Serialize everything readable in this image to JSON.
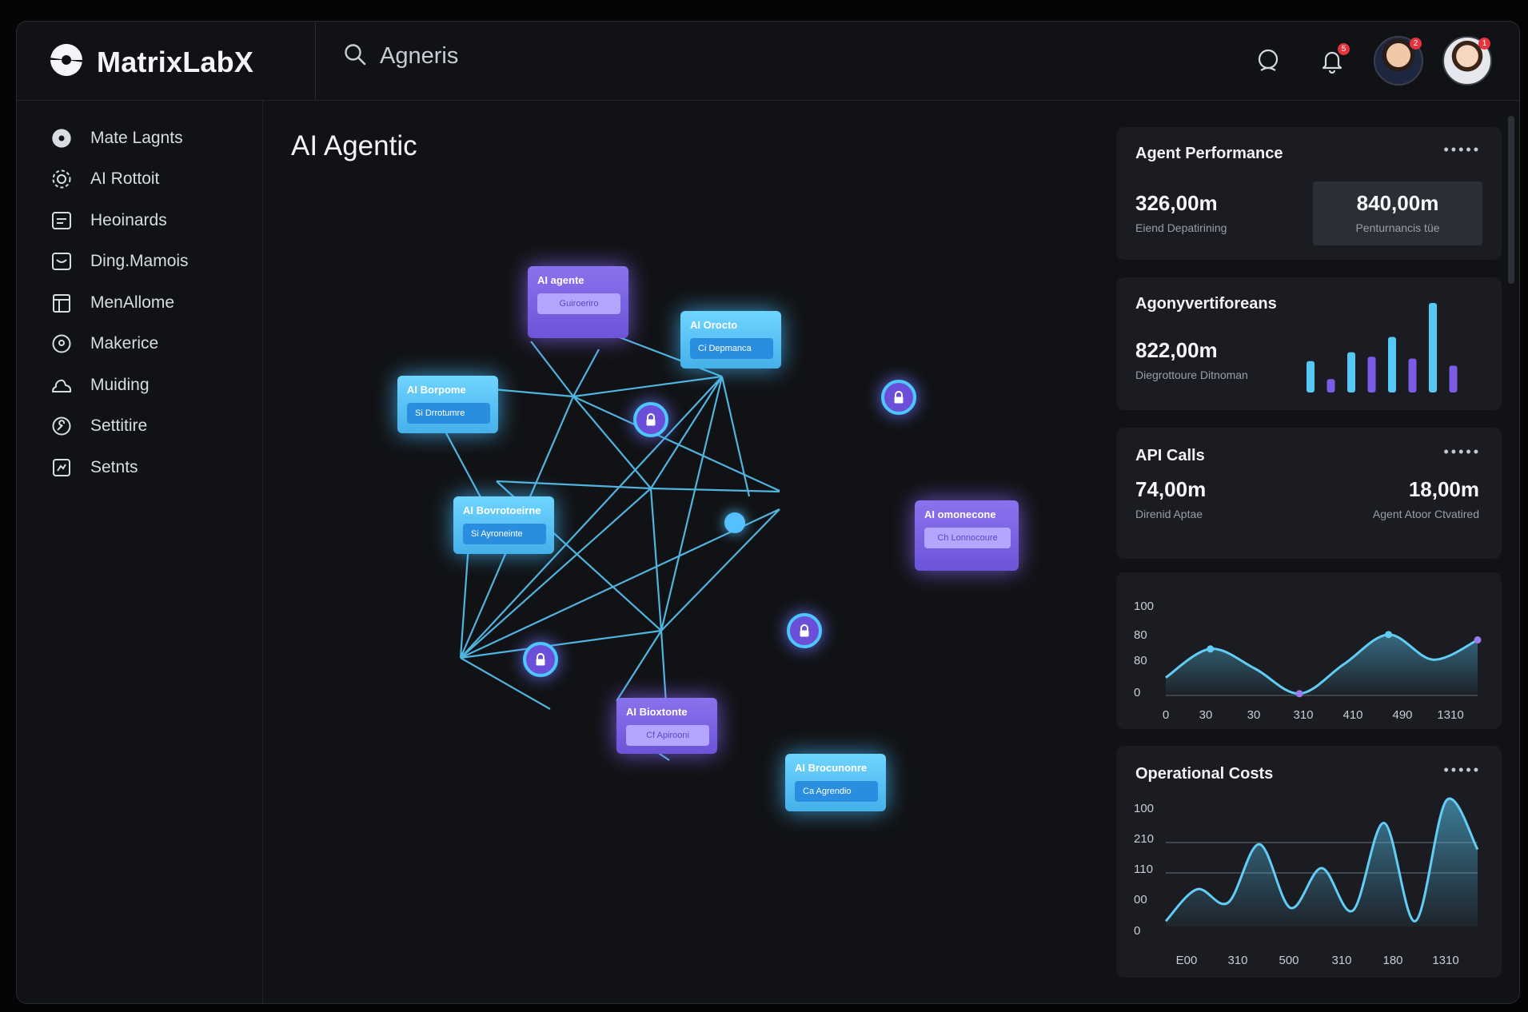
{
  "brand": {
    "name": "MatrixLabX"
  },
  "search": {
    "value": "Agneris"
  },
  "header": {
    "notification_badge": "5",
    "avatar1_badge": "2",
    "avatar2_badge": "1"
  },
  "sidebar": {
    "items": [
      {
        "label": "Mate Lagnts",
        "icon": "logo-icon"
      },
      {
        "label": "AI Rottoit",
        "icon": "gear-icon"
      },
      {
        "label": "Heoinards",
        "icon": "dashboard-icon"
      },
      {
        "label": "Ding.Mamois",
        "icon": "inbox-icon"
      },
      {
        "label": "MenAllome",
        "icon": "calendar-icon"
      },
      {
        "label": "Makerice",
        "icon": "location-icon"
      },
      {
        "label": "Muiding",
        "icon": "cloud-icon"
      },
      {
        "label": "Settitire",
        "icon": "wrench-icon"
      },
      {
        "label": "Setnts",
        "icon": "settings-box-icon"
      }
    ]
  },
  "main": {
    "title": "AI Agentic"
  },
  "graph": {
    "nodes": [
      {
        "title": "AI agente",
        "sub": "Guiroeriro",
        "color": "purple"
      },
      {
        "title": "AI Orocto",
        "sub": "Ci Depmanca",
        "color": "cyan"
      },
      {
        "title": "AI Borpome",
        "sub": "Si Drrotumre",
        "color": "cyan"
      },
      {
        "title": "AI Bovrotoeirne",
        "sub": "Si Ayroneinte",
        "color": "cyan"
      },
      {
        "title": "AI omonecone",
        "sub": "Ch Lonnocoure",
        "color": "purple"
      },
      {
        "title": "AI Bioxtonte",
        "sub": "Cf Apirooni",
        "color": "purple"
      },
      {
        "title": "AI Brocunonre",
        "sub": "Ca Agrendio",
        "color": "cyan"
      }
    ]
  },
  "panels": {
    "performance": {
      "title": "Agent Performance",
      "value1": "326,00m",
      "sub1": "Eiend Depatirining",
      "value2": "840,00m",
      "sub2": "Penturnancis tüe"
    },
    "agents": {
      "title": "Agonyvertiforeans",
      "value": "822,00m",
      "sub": "Diegrottoure Ditnoman",
      "bars": [
        0.35,
        0.15,
        0.45,
        0.4,
        0.62,
        0.38,
        1.0,
        0.3
      ]
    },
    "api": {
      "title": "API Calls",
      "value1": "74,00m",
      "sub1": "Direnid Aptae",
      "value2": "18,00m",
      "sub2": "Agent Atoor Ctvatired"
    },
    "colors": {
      "cyan": "#56c8f5",
      "purple": "#7b5ce6",
      "panel": "#1b1c21"
    }
  },
  "chart_data": [
    {
      "type": "line",
      "title": "",
      "x_ticks": [
        "0",
        "30",
        "30",
        "310",
        "410",
        "490",
        "1310"
      ],
      "y_ticks": [
        "100",
        "80",
        "80",
        "0"
      ],
      "series": [
        {
          "values": [
            20,
            52,
            30,
            2,
            35,
            68,
            40,
            62
          ]
        }
      ],
      "markers": [
        1,
        3,
        5,
        7
      ],
      "ylim": [
        0,
        100
      ]
    },
    {
      "type": "area",
      "title": "Operational Costs",
      "x_ticks": [
        "E00",
        "310",
        "500",
        "310",
        "180",
        "1310"
      ],
      "y_ticks": [
        "100",
        "210",
        "110",
        "00",
        "0"
      ],
      "series": [
        {
          "values": [
            4,
            28,
            18,
            62,
            14,
            44,
            12,
            78,
            4,
            95,
            58
          ]
        }
      ],
      "ylim": [
        0,
        100
      ]
    }
  ]
}
